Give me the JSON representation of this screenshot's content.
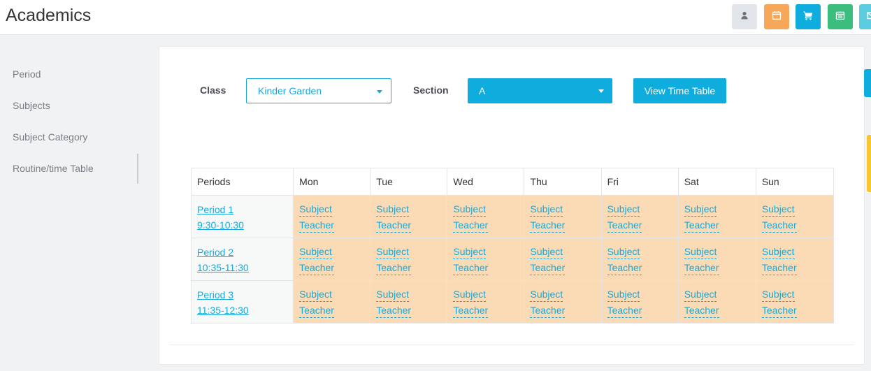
{
  "header": {
    "title": "Academics",
    "buttons": [
      {
        "icon": "user-icon",
        "color": "#e2e5e9",
        "glyph": "#6f7378"
      },
      {
        "icon": "calendar-icon",
        "color": "#f6a75a",
        "glyph": "#ffffff"
      },
      {
        "icon": "cart-icon",
        "color": "#0fadde",
        "glyph": "#ffffff"
      },
      {
        "icon": "calendar-check-icon",
        "color": "#3bbd7e",
        "glyph": "#ffffff"
      },
      {
        "icon": "mail-icon",
        "color": "#5ccde0",
        "glyph": "#ffffff"
      }
    ]
  },
  "sidebar": {
    "items": [
      {
        "label": "Period"
      },
      {
        "label": "Subjects"
      },
      {
        "label": "Subject Category"
      },
      {
        "label": "Routine/time Table"
      }
    ]
  },
  "filters": {
    "class_label": "Class",
    "class_value": "Kinder Garden",
    "section_label": "Section",
    "section_value": "A",
    "view_button": "View Time Table"
  },
  "timetable": {
    "columns": [
      "Periods",
      "Mon",
      "Tue",
      "Wed",
      "Thu",
      "Fri",
      "Sat",
      "Sun"
    ],
    "rows": [
      {
        "period": "Period 1",
        "time": "9:30-10:30"
      },
      {
        "period": "Period 2",
        "time": "10:35-11:30"
      },
      {
        "period": "Period 3",
        "time": "11:35-12:30"
      }
    ],
    "cell_subject": "Subject",
    "cell_teacher": "Teacher"
  },
  "colors": {
    "accent": "#0fadde",
    "slot_bg": "#fadbb6"
  }
}
